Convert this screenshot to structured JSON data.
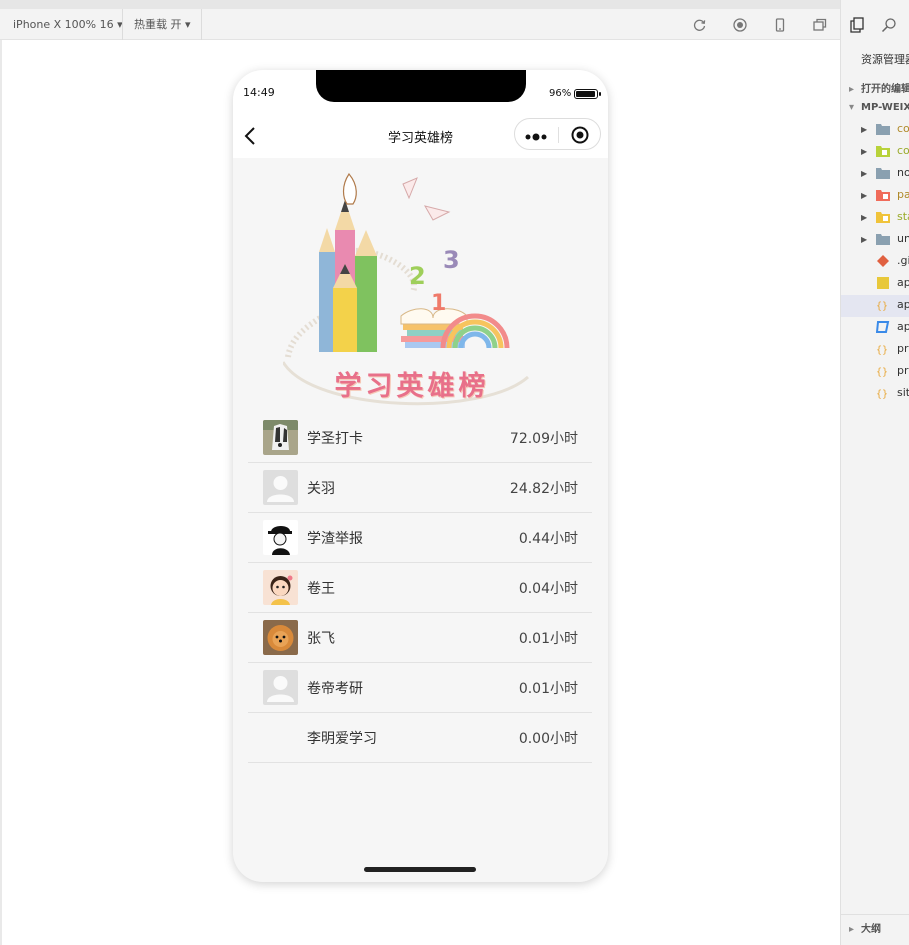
{
  "toolbar": {
    "device_label": "iPhone X 100% 16 ▾",
    "hotreload_label": "热重载 开 ▾"
  },
  "phone": {
    "status": {
      "time": "14:49",
      "battery": "96%"
    },
    "nav": {
      "title": "学习英雄榜"
    },
    "banner": {
      "title": "学习英雄榜",
      "digits": [
        "2",
        "3",
        "1"
      ]
    },
    "leaderboard": [
      {
        "name": "学圣打卡",
        "hours": "72.09小时",
        "avatar": "dog-avatar"
      },
      {
        "name": "关羽",
        "hours": "24.82小时",
        "avatar": "default-avatar"
      },
      {
        "name": "学渣举报",
        "hours": "0.44小时",
        "avatar": "silhouette-avatar"
      },
      {
        "name": "卷王",
        "hours": "0.04小时",
        "avatar": "cartoon-girl-avatar"
      },
      {
        "name": "张飞",
        "hours": "0.01小时",
        "avatar": "pomeranian-avatar"
      },
      {
        "name": "卷帝考研",
        "hours": "0.01小时",
        "avatar": "default-avatar"
      },
      {
        "name": "李明爱学习",
        "hours": "0.00小时",
        "avatar": "none"
      }
    ]
  },
  "explorer": {
    "title": "资源管理器",
    "open_editors": "打开的编辑器",
    "project": "MP-WEIXIN",
    "items": [
      {
        "name": "co",
        "icon": "folder-icon",
        "color": "#8aa0b0"
      },
      {
        "name": "co",
        "icon": "components-folder-icon",
        "color": "#b8d23a"
      },
      {
        "name": "no",
        "icon": "folder-icon",
        "color": "#8aa0b0"
      },
      {
        "name": "pa",
        "icon": "pages-folder-icon",
        "color": "#f06b5a"
      },
      {
        "name": "sta",
        "icon": "static-folder-icon",
        "color": "#f0c33a"
      },
      {
        "name": "un",
        "icon": "folder-icon",
        "color": "#8aa0b0"
      },
      {
        "name": ".gi",
        "icon": "git-icon",
        "color": "#e06040"
      },
      {
        "name": "ap",
        "icon": "js-file-icon",
        "color": "#e8c83a"
      },
      {
        "name": "ap",
        "icon": "json-file-icon",
        "color": "#e8a83a"
      },
      {
        "name": "ap",
        "icon": "css-file-icon",
        "color": "#3a8ae8"
      },
      {
        "name": "pr",
        "icon": "json-file-icon",
        "color": "#e8a83a"
      },
      {
        "name": "pr",
        "icon": "json-file-icon",
        "color": "#e8a83a"
      },
      {
        "name": "sit",
        "icon": "json-file-icon",
        "color": "#e8a83a"
      }
    ],
    "outline": "大纲"
  }
}
